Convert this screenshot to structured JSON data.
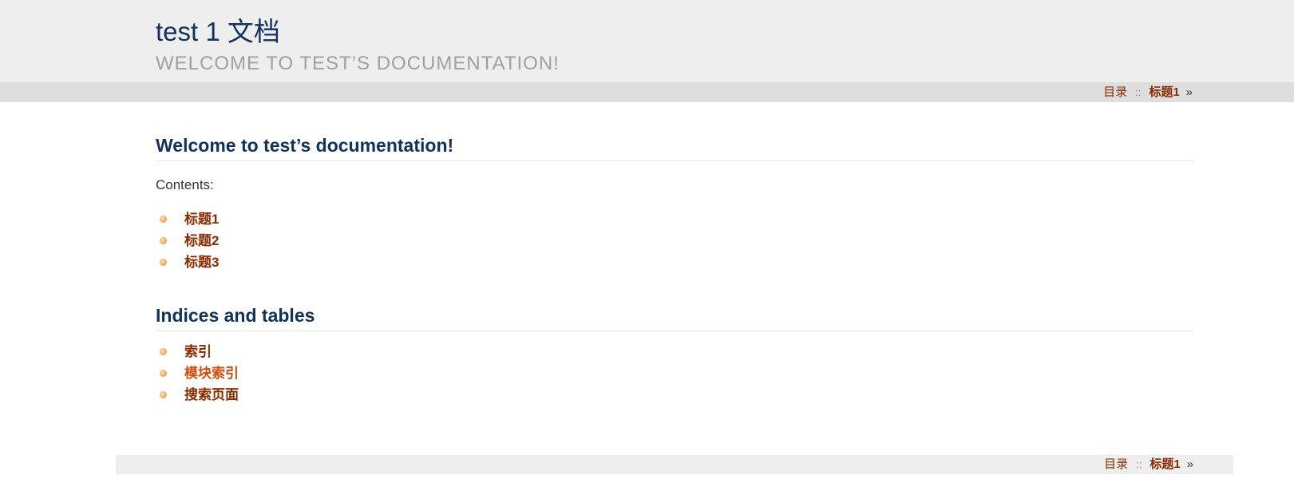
{
  "header": {
    "title": "test 1 文档",
    "subtitle": "WELCOME TO TEST’S DOCUMENTATION!"
  },
  "nav": {
    "toc_label": "目录",
    "separator": "::",
    "next_label": "标题1",
    "next_arrow": "»"
  },
  "main": {
    "heading": "Welcome to test’s documentation!",
    "contents_label": "Contents:",
    "toc": [
      {
        "label": "标题1"
      },
      {
        "label": "标题2"
      },
      {
        "label": "标题3"
      }
    ],
    "indices_heading": "Indices and tables",
    "indices": [
      {
        "label": "索引"
      },
      {
        "label": "模块索引"
      },
      {
        "label": "搜索页面"
      }
    ]
  },
  "colors": {
    "title": "#11335a",
    "link": "#8a2b00",
    "link_hover": "#d44a0a",
    "header_bg": "#eeeeee",
    "nav_bg": "#dedede"
  }
}
